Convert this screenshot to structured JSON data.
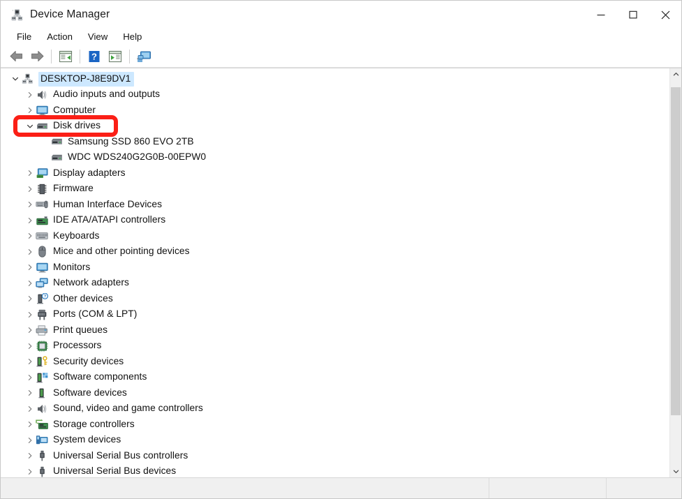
{
  "window": {
    "title": "Device Manager",
    "app_icon": "device-manager-icon",
    "controls": {
      "minimize": "minimize-icon",
      "maximize": "maximize-icon",
      "close": "close-icon"
    }
  },
  "menubar": {
    "items": [
      {
        "label": "File"
      },
      {
        "label": "Action"
      },
      {
        "label": "View"
      },
      {
        "label": "Help"
      }
    ]
  },
  "toolbar": {
    "buttons": [
      {
        "name": "back-button",
        "icon": "back-arrow-icon"
      },
      {
        "name": "forward-button",
        "icon": "forward-arrow-icon"
      },
      {
        "name": "properties-button",
        "icon": "properties-window-icon"
      },
      {
        "name": "help-button",
        "icon": "help-question-icon"
      },
      {
        "name": "scan-hardware-changes-button",
        "icon": "scan-play-window-icon"
      },
      {
        "name": "show-hide-console-tree-button",
        "icon": "console-monitor-icon"
      }
    ]
  },
  "tree": {
    "root": {
      "label": "DESKTOP-J8E9DV1",
      "icon": "computer-hub-icon",
      "expanded": true,
      "selected": true
    },
    "nodes": [
      {
        "label": "Audio inputs and outputs",
        "icon": "speaker-icon",
        "level": 1,
        "expanded": false
      },
      {
        "label": "Computer",
        "icon": "monitor-icon",
        "level": 1,
        "expanded": false
      },
      {
        "label": "Disk drives",
        "icon": "disk-drive-icon",
        "level": 1,
        "expanded": true,
        "highlighted": true
      },
      {
        "label": "Samsung SSD 860 EVO 2TB",
        "icon": "disk-drive-icon",
        "level": 2,
        "leaf": true
      },
      {
        "label": "WDC WDS240G2G0B-00EPW0",
        "icon": "disk-drive-icon",
        "level": 2,
        "leaf": true
      },
      {
        "label": "Display adapters",
        "icon": "display-adapter-icon",
        "level": 1,
        "expanded": false
      },
      {
        "label": "Firmware",
        "icon": "firmware-chip-icon",
        "level": 1,
        "expanded": false
      },
      {
        "label": "Human Interface Devices",
        "icon": "hid-icon",
        "level": 1,
        "expanded": false
      },
      {
        "label": "IDE ATA/ATAPI controllers",
        "icon": "ide-controller-icon",
        "level": 1,
        "expanded": false
      },
      {
        "label": "Keyboards",
        "icon": "keyboard-icon",
        "level": 1,
        "expanded": false
      },
      {
        "label": "Mice and other pointing devices",
        "icon": "mouse-icon",
        "level": 1,
        "expanded": false
      },
      {
        "label": "Monitors",
        "icon": "monitor-icon",
        "level": 1,
        "expanded": false
      },
      {
        "label": "Network adapters",
        "icon": "network-adapter-icon",
        "level": 1,
        "expanded": false
      },
      {
        "label": "Other devices",
        "icon": "unknown-device-icon",
        "level": 1,
        "expanded": false
      },
      {
        "label": "Ports (COM & LPT)",
        "icon": "port-connector-icon",
        "level": 1,
        "expanded": false
      },
      {
        "label": "Print queues",
        "icon": "printer-icon",
        "level": 1,
        "expanded": false
      },
      {
        "label": "Processors",
        "icon": "processor-chip-icon",
        "level": 1,
        "expanded": false
      },
      {
        "label": "Security devices",
        "icon": "security-key-icon",
        "level": 1,
        "expanded": false
      },
      {
        "label": "Software components",
        "icon": "software-component-icon",
        "level": 1,
        "expanded": false
      },
      {
        "label": "Software devices",
        "icon": "software-device-icon",
        "level": 1,
        "expanded": false
      },
      {
        "label": "Sound, video and game controllers",
        "icon": "speaker-icon",
        "level": 1,
        "expanded": false
      },
      {
        "label": "Storage controllers",
        "icon": "storage-controller-icon",
        "level": 1,
        "expanded": false
      },
      {
        "label": "System devices",
        "icon": "system-device-icon",
        "level": 1,
        "expanded": false
      },
      {
        "label": "Universal Serial Bus controllers",
        "icon": "usb-icon",
        "level": 1,
        "expanded": false
      },
      {
        "label": "Universal Serial Bus devices",
        "icon": "usb-icon",
        "level": 1,
        "expanded": false
      }
    ]
  },
  "annotation": {
    "target_label": "Disk drives",
    "color": "#fb1f16",
    "shape": "rounded-rectangle"
  },
  "scrollbar": {
    "up_arrow": "chevron-up-icon",
    "down_arrow": "chevron-down-icon",
    "orientation": "vertical"
  },
  "statusbar": {
    "pane1": "",
    "pane2": "",
    "pane3": ""
  },
  "colors": {
    "selection": "#cde8ff",
    "annotation_red": "#fb1f16",
    "statusbar_bg": "#f0f0f0",
    "scrollbar_thumb": "#cdcdcd"
  }
}
